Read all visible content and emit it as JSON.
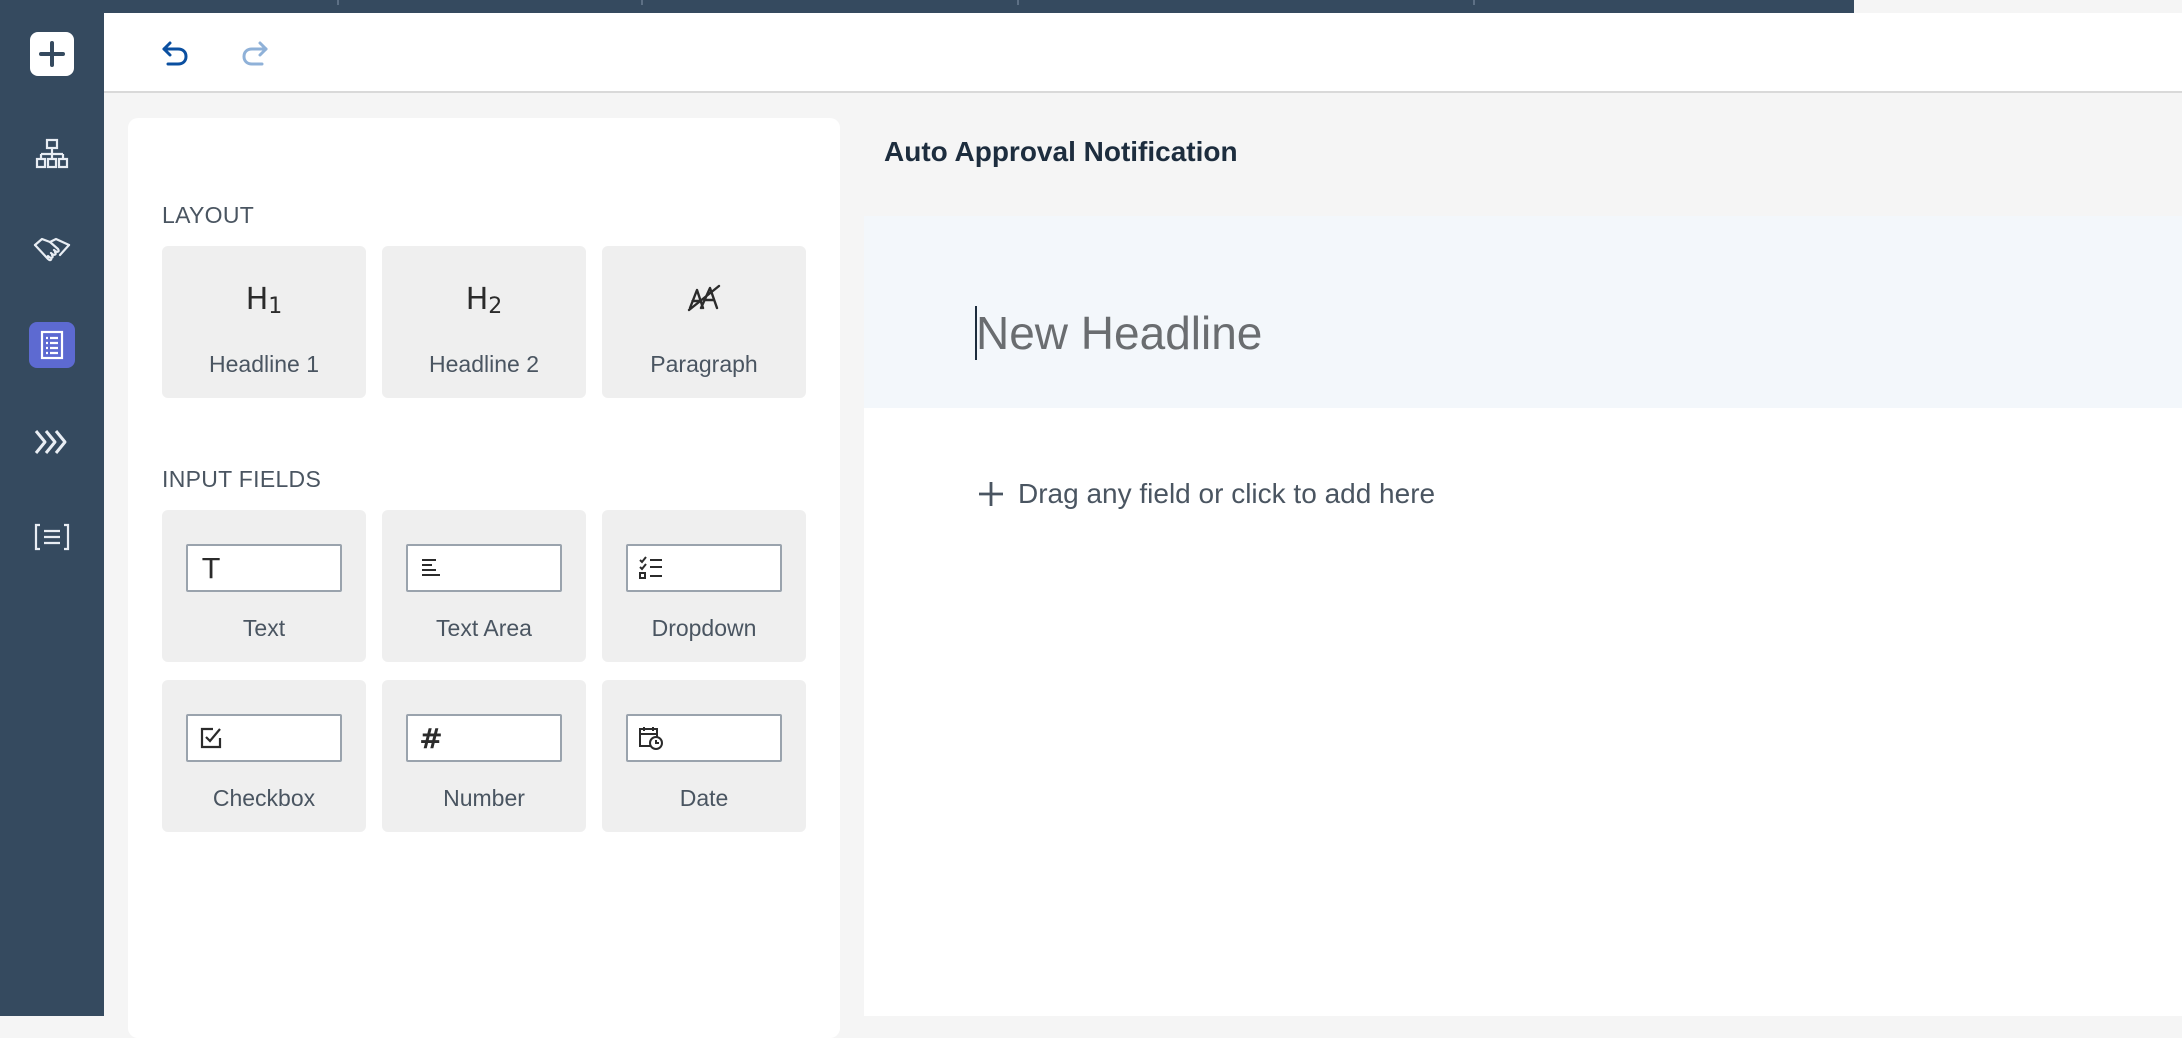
{
  "colors": {
    "sidebar": "#354a5f",
    "selected_nav": "#5d6ad1",
    "undo_active": "#0a4fa0",
    "redo_inactive": "#8fb1d8",
    "tile_bg": "#efefef"
  },
  "sidebar": {
    "items": [
      {
        "name": "add",
        "icon": "plus-icon"
      },
      {
        "name": "process",
        "icon": "hierarchy-icon"
      },
      {
        "name": "approval",
        "icon": "handshake-icon"
      },
      {
        "name": "forms",
        "icon": "document-list-icon",
        "selected": true
      },
      {
        "name": "automation",
        "icon": "chevrons-right-icon"
      },
      {
        "name": "decision",
        "icon": "bracket-list-icon"
      }
    ]
  },
  "toolbar": {
    "undo_icon": "undo-icon",
    "redo_icon": "redo-icon"
  },
  "palette": {
    "layout_label": "LAYOUT",
    "layout_items": [
      {
        "glyph": "H",
        "sub": "1",
        "label": "Headline 1"
      },
      {
        "glyph": "H",
        "sub": "2",
        "label": "Headline 2"
      },
      {
        "glyph": "paragraph-icon",
        "label": "Paragraph"
      }
    ],
    "input_label": "INPUT FIELDS",
    "input_items": [
      {
        "icon": "text-icon",
        "glyph": "T",
        "label": "Text"
      },
      {
        "icon": "text-area-icon",
        "label": "Text Area"
      },
      {
        "icon": "dropdown-icon",
        "label": "Dropdown"
      },
      {
        "icon": "checkbox-icon",
        "label": "Checkbox"
      },
      {
        "icon": "number-icon",
        "glyph": "#",
        "label": "Number"
      },
      {
        "icon": "date-icon",
        "label": "Date"
      }
    ]
  },
  "form": {
    "title": "Auto Approval Notification",
    "headline_placeholder": "New Headline",
    "add_field_text": "Drag any field or click to add here"
  }
}
